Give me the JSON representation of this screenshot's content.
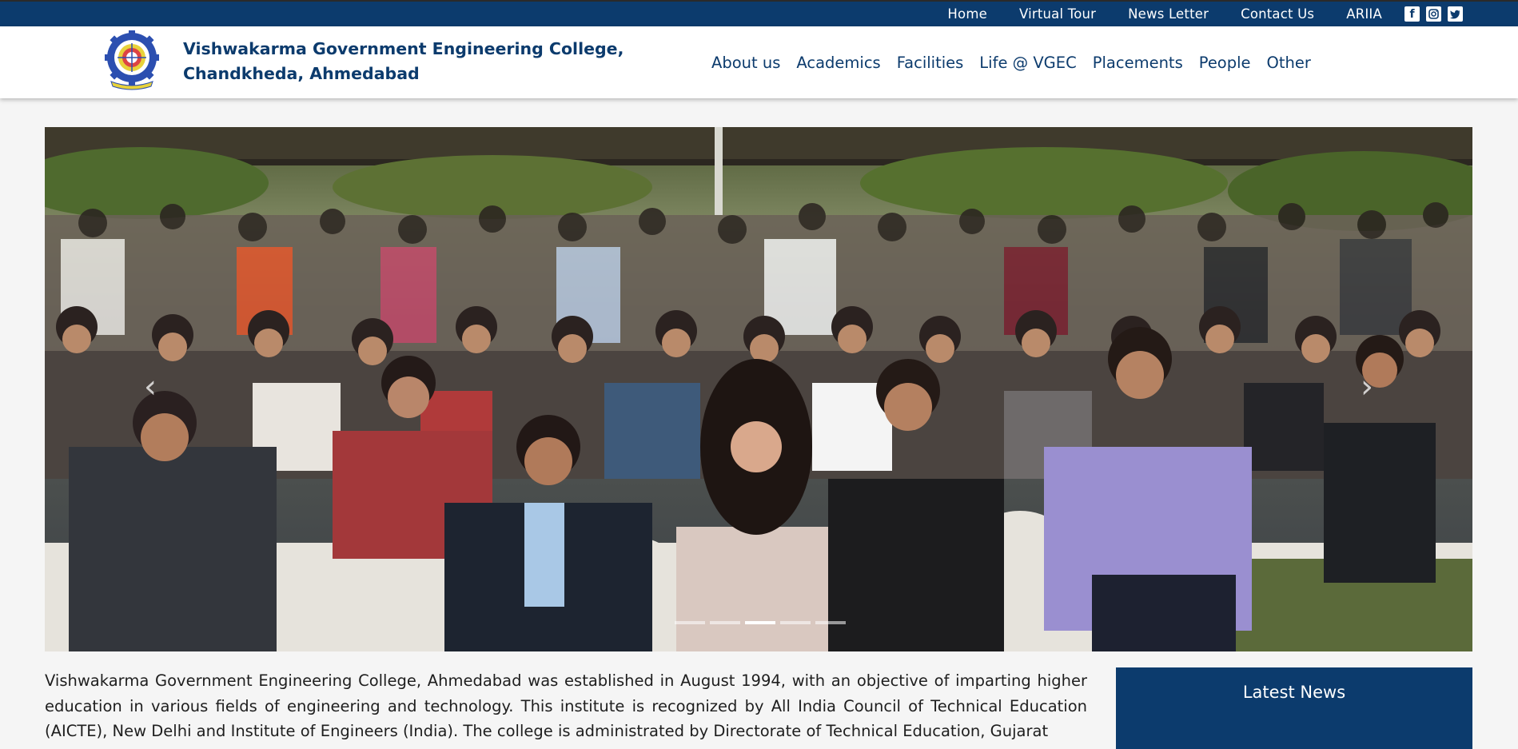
{
  "topbar": {
    "links": [
      "Home",
      "Virtual Tour",
      "News Letter",
      "Contact Us",
      "ARIIA"
    ],
    "social_icons": [
      "facebook-icon",
      "instagram-icon",
      "twitter-icon"
    ]
  },
  "header": {
    "college_name_line1": "Vishwakarma Government Engineering College,",
    "college_name_line2": "Chandkheda, Ahmedabad",
    "logo_icon": "college-logo-gear-emblem",
    "nav": [
      "About us",
      "Academics",
      "Facilities",
      "Life @ VGEC",
      "Placements",
      "People",
      "Other"
    ]
  },
  "carousel": {
    "image_icon": "crowd-photo",
    "prev_glyph": "‹",
    "next_glyph": "›",
    "slide_count": 5,
    "active_slide": 3
  },
  "about": {
    "text": "Vishwakarma Government Engineering College, Ahmedabad was established in August 1994, with an objective of imparting higher education in various fields of engineering and technology. This institute is recognized by All India Council of Technical Education (AICTE), New Delhi and Institute of Engineers (India). The college is administrated by Directorate of Technical Education, Gujarat"
  },
  "news": {
    "title": "Latest News"
  },
  "colors": {
    "brand_blue": "#0c3b6d",
    "background": "#f5f5f5"
  }
}
